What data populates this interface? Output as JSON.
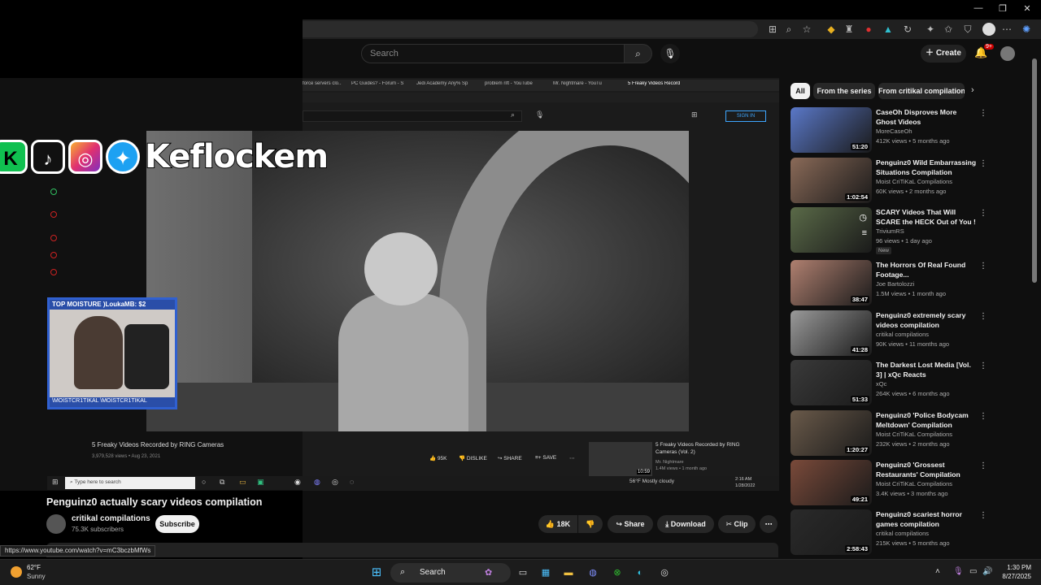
{
  "window": {
    "minimize": "—",
    "maximize": "❐",
    "close": "✕"
  },
  "yt_header": {
    "search_placeholder": "Search",
    "create_label": "Create",
    "notification_count": "9+"
  },
  "inner_browser": {
    "tabs": [
      "force servers clo...",
      "PC Guides? - Forum - S",
      "Jedi Academy Any% Sp",
      "problem rift - YouTube",
      "Mr. Nightmare - YouTu",
      "5 Freaky Videos Record"
    ],
    "sign_in": "SIGN IN",
    "video_title": "5 Freaky Videos Recorded by RING Cameras",
    "video_meta": "3,979,528 views • Aug 23, 2021",
    "likes": "95K",
    "dislike": "DISLIKE",
    "share": "SHARE",
    "save": "SAVE",
    "rec_title": "5 Freaky Videos Recorded by RING Cameras (Vol. 2)",
    "rec_channel": "Mr. Nightmare",
    "rec_meta": "1.4M views • 1 month ago",
    "rec_duration": "10:59",
    "taskbar_search": "Type here to search",
    "weather": "56°F  Mostly cloudy",
    "time": "2:16 AM",
    "date": "1/28/2022"
  },
  "overlay": {
    "social_k": "K",
    "social_name": "Keflockem",
    "cam_top": "TOP MOISTURE  )LoukaMB: $2",
    "cam_bottom": "\\MOISTCR1TIKAL   \\MOISTCR1TIKAL"
  },
  "video": {
    "title": "Penguinz0 actually scary videos compilation",
    "channel": "critikal compilations",
    "subscribers": "75.3K subscribers",
    "subscribe_label": "Subscribe",
    "likes": "18K",
    "share_label": "Share",
    "download_label": "Download",
    "clip_label": "Clip",
    "status_url": "https://www.youtube.com/watch?v=mC3bczbMfWs"
  },
  "chips": [
    "All",
    "From the series",
    "From critikal compilation"
  ],
  "recommendations": [
    {
      "title": "CaseOh Disproves More Ghost Videos",
      "channel": "MoreCaseOh",
      "meta": "412K views • 5 months ago",
      "duration": "51:20",
      "color": "#5a78c8"
    },
    {
      "title": "Penguinz0 Wild Embarrassing Situations Compilation",
      "channel": "Moist CriTiKaL Compilations",
      "meta": "60K views • 2 months ago",
      "duration": "1:02:54",
      "color": "#8a6a58"
    },
    {
      "title": "SCARY Videos That Will SCARE the HECK Out of You ! | Nuke's ...",
      "channel": "TriviumRS",
      "meta": "96 views • 1 day ago",
      "duration": "",
      "badge": "New",
      "color": "#5a6a48"
    },
    {
      "title": "The Horrors Of Real Found Footage...",
      "channel": "Joe Bartolozzi",
      "meta": "1.5M views • 1 month ago",
      "duration": "38:47",
      "color": "#b08070"
    },
    {
      "title": "Penguinz0 extremely scary videos compilation",
      "channel": "critikal compilations",
      "meta": "90K views • 11 months ago",
      "duration": "41:28",
      "color": "#9a9a9a"
    },
    {
      "title": "The Darkest Lost Media [Vol. 3] | xQc Reacts",
      "channel": "xQc",
      "meta": "264K views • 6 months ago",
      "duration": "51:33",
      "color": "#3a3a3a"
    },
    {
      "title": "Penguinz0 'Police Bodycam Meltdown' Compilation",
      "channel": "Moist CriTiKaL Compilations",
      "meta": "232K views • 2 months ago",
      "duration": "1:20:27",
      "color": "#6a5a4a"
    },
    {
      "title": "Penguinz0 'Grossest Restaurants' Compilation",
      "channel": "Moist CriTiKaL Compilations",
      "meta": "3.4K views • 3 months ago",
      "duration": "49:21",
      "color": "#7a4a3a"
    },
    {
      "title": "Penguinz0 scariest horror games compilation",
      "channel": "critikal compilations",
      "meta": "215K views • 5 months ago",
      "duration": "2:58:43",
      "color": "#2a2a2a"
    }
  ],
  "taskbar": {
    "temp": "62°F",
    "weather": "Sunny",
    "search_label": "Search",
    "time": "1:30 PM",
    "date": "8/27/2025"
  }
}
